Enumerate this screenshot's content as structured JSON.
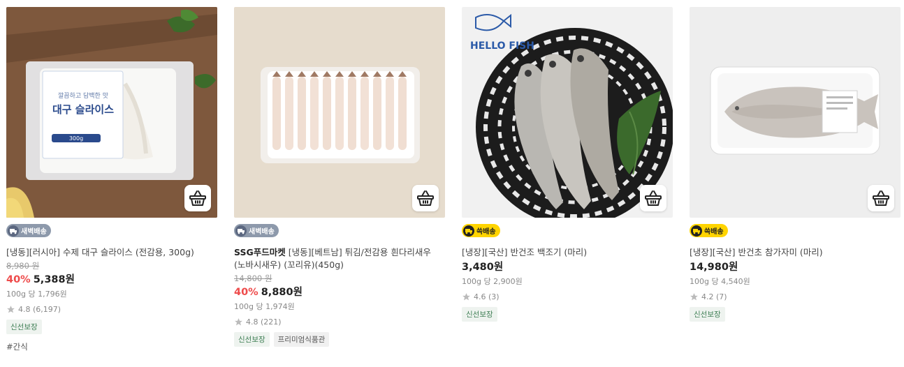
{
  "products": [
    {
      "badge": "새벽배송",
      "title_brand": "",
      "title": "[냉동][러시아] 수제 대구 슬라이스 (전감용, 300g)",
      "original_price": "8,980 원",
      "discount_rate": "40%",
      "price": "5,388원",
      "unit_price": "100g 당 1,796원",
      "rating": "4.8 (6,197)",
      "tags": [
        "신선보장"
      ],
      "hashtag": "#간식",
      "package_text": "대구 슬라이스"
    },
    {
      "badge": "새벽배송",
      "title_brand": "SSG푸드마켓",
      "title": " [냉동][베트남] 튀김/전감용 흰다리새우 (노바시새우) (꼬리유)(450g)",
      "original_price": "14,800 원",
      "discount_rate": "40%",
      "price": "8,880원",
      "unit_price": "100g 당 1,974원",
      "rating": "4.8 (221)",
      "tags": [
        "신선보장",
        "프리미엄식품관"
      ]
    },
    {
      "badge": "쓱배송",
      "title_brand": "",
      "title": "[냉장][국산] 반건조 백조기 (마리)",
      "price": "3,480원",
      "unit_price": "100g 당 2,900원",
      "rating": "4.6 (3)",
      "tags": [
        "신선보장"
      ],
      "logo_text": "HELLO FISH"
    },
    {
      "badge": "쓱배송",
      "title_brand": "",
      "title": "[냉장][국산] 반건초 참가자미 (마리)",
      "price": "14,980원",
      "unit_price": "100g 당 4,540원",
      "rating": "4.2 (7)",
      "tags": [
        "신선보장"
      ]
    }
  ]
}
